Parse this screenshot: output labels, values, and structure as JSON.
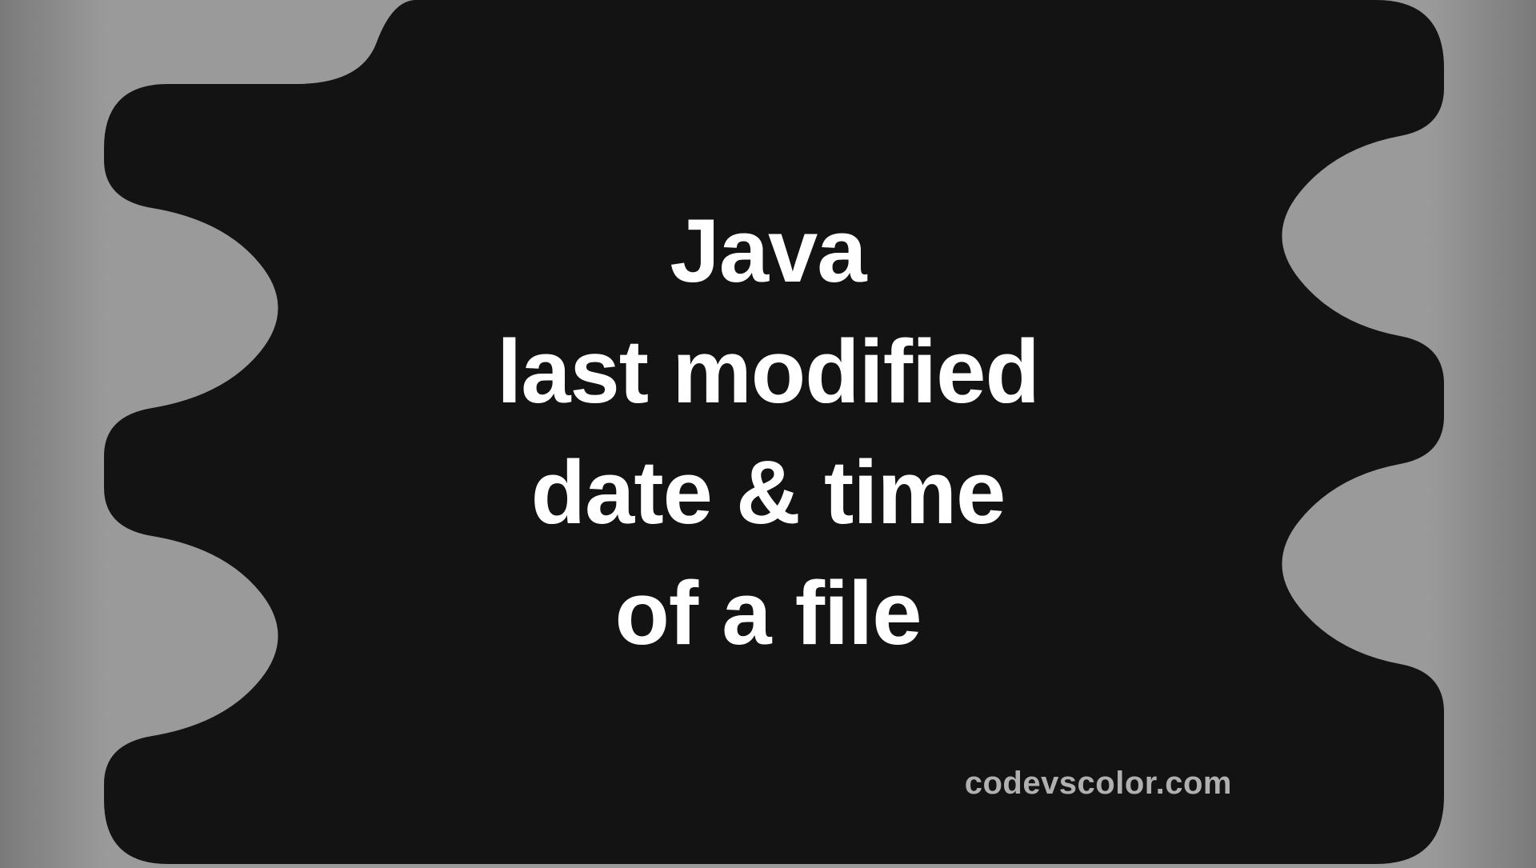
{
  "title": {
    "line1": "Java",
    "line2": "last modified",
    "line3": "date & time",
    "line4": "of a file"
  },
  "watermark": "codevscolor.com",
  "colors": {
    "shape": "#131313",
    "text": "#ffffff",
    "watermark": "#b0b0b0",
    "bg_gradient_dark": "#7a7a7a",
    "bg_gradient_light": "#9a9a9a"
  }
}
